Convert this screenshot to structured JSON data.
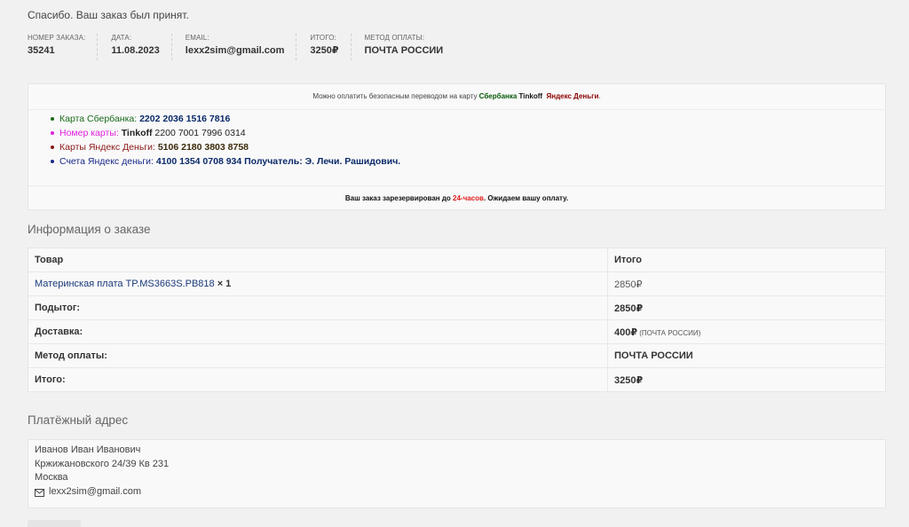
{
  "thanks": "Спасибо. Ваш заказ был принят.",
  "overview": [
    {
      "label": "Номер заказа:",
      "value": "35241"
    },
    {
      "label": "Дата:",
      "value": "11.08.2023"
    },
    {
      "label": "Email:",
      "value": "lexx2sim@gmail.com"
    },
    {
      "label": "Итого:",
      "value": "3250₽"
    },
    {
      "label": "Метод оплаты:",
      "value": "ПОЧТА РОССИИ"
    }
  ],
  "payment_box": {
    "intro": "Можно оплатить безопасным переводом на карту ",
    "bank1": "Сбербанка",
    "bank2": "Tinkoff",
    "bank3": "Яндекс Деньги",
    "intro_end": ".",
    "methods": [
      {
        "label": "Карта Сбербанка: ",
        "number": "2202 2036 1516 7816"
      },
      {
        "label": "Номер карты: ",
        "number_prefix": "Tinkoff",
        "number": " 2200 7001 7996 0314"
      },
      {
        "label": "Карты Яндекс Деньги: ",
        "number": "5106 2180 3803 8758"
      },
      {
        "label": "Счета Яндекс деньги: ",
        "number": "4100 1354 0708 934 Получатель: Э. Лечи. Рашидович."
      }
    ],
    "reserve_before": "Ваш заказ зарезервирован до ",
    "reserve_highlight": "24-часов",
    "reserve_after": ". Ожидаем вашу оплату.",
    "colors": {
      "green": "#0a5a0a",
      "pink": "#e21ee0",
      "red": "#e31b1b",
      "navy": "#1a2a8a"
    }
  },
  "order_details": {
    "heading": "Информация о заказе",
    "col_product": "Товар",
    "col_total": "Итого",
    "product_name": "Материнская плата TP.MS3663S.PB818",
    "product_qty": " × 1",
    "product_price": "2850₽",
    "rows": [
      {
        "label": "Подытог:",
        "value": "2850₽",
        "note": ""
      },
      {
        "label": "Доставка:",
        "value": "400₽",
        "note": " (ПОЧТА РОССИИ)"
      },
      {
        "label": "Метод оплаты:",
        "value": "ПОЧТА РОССИИ",
        "note": ""
      },
      {
        "label": "Итого:",
        "value": "3250₽",
        "note": ""
      }
    ]
  },
  "billing": {
    "heading": "Платёжный адрес",
    "name": "Иванов Иван Иванович",
    "street": "Кржижановского 24/39 Кв 231",
    "city": "Москва",
    "email": "lexx2sim@gmail.com",
    "email_icon": "envelope-icon"
  }
}
